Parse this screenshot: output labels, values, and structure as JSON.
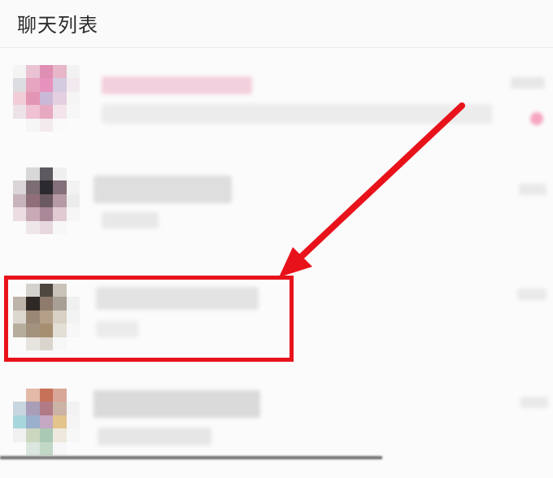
{
  "header": {
    "title": "聊天列表"
  },
  "annotation": {
    "color": "#e8121b"
  },
  "chats": [
    {
      "palette": [
        "#f4f4f4",
        "#e9c3d4",
        "#df8fb4",
        "#e7b6c9",
        "#f2f2f2",
        "#dcdde0",
        "#e8a5c0",
        "#e792bd",
        "#d4cbe0",
        "#f2e9ef",
        "#f0cdd7",
        "#e396b4",
        "#cab9d6",
        "#e4cfe0",
        "#f5f5f5",
        "#ede2e8",
        "#efc1d2",
        "#e6a9c1",
        "#f2e4ea",
        "#f7f7f7",
        "#fbfbfb",
        "#f6f6f6",
        "#f3eaee",
        "#fafafa",
        "#fbfbfb"
      ]
    },
    {
      "palette": [
        "#fbfbfb",
        "#d8d8d8",
        "#5c5a5f",
        "#f0f0f0",
        "#fbfbfb",
        "#dad5d8",
        "#7b6d73",
        "#2b2a2e",
        "#84707a",
        "#f2f2f2",
        "#c7b3bc",
        "#8f6e7a",
        "#6b5962",
        "#b69aa6",
        "#ececec",
        "#ecdde3",
        "#c8a9b5",
        "#ab8897",
        "#e1cad2",
        "#f6f6f6",
        "#fbfbfb",
        "#eee6e9",
        "#e6d8de",
        "#f7f7f7",
        "#fbfbfb"
      ]
    },
    {
      "palette": [
        "#fbfbfb",
        "#d4d2cd",
        "#4d4740",
        "#c9c2b8",
        "#fbfbfb",
        "#bdb4aa",
        "#2f2926",
        "#8e7b6c",
        "#a89f95",
        "#f0f0f0",
        "#dcd7cf",
        "#9a8875",
        "#b4a088",
        "#d9d1c4",
        "#f3f3f3",
        "#b6ad9c",
        "#a3927d",
        "#a68f70",
        "#e3ded6",
        "#f7f7f7",
        "#fbfbfb",
        "#e7e3de",
        "#dad5cc",
        "#f7f7f7",
        "#fbfbfb"
      ]
    },
    {
      "palette": [
        "#fbfbfb",
        "#e3b9a8",
        "#c77158",
        "#d9a798",
        "#fbfbfb",
        "#c9d6e0",
        "#a99db8",
        "#b07a86",
        "#cbb3a6",
        "#f2f2f2",
        "#a7d6dc",
        "#9bb0cd",
        "#c5a8c2",
        "#e4c48d",
        "#f5f5f5",
        "#f0f0f0",
        "#cdd7c0",
        "#a9c9b4",
        "#eee8df",
        "#f7f7f7",
        "#fbfbfb",
        "#dbe6de",
        "#c2d8c6",
        "#f7f7f7",
        "#fbfbfb"
      ]
    }
  ]
}
